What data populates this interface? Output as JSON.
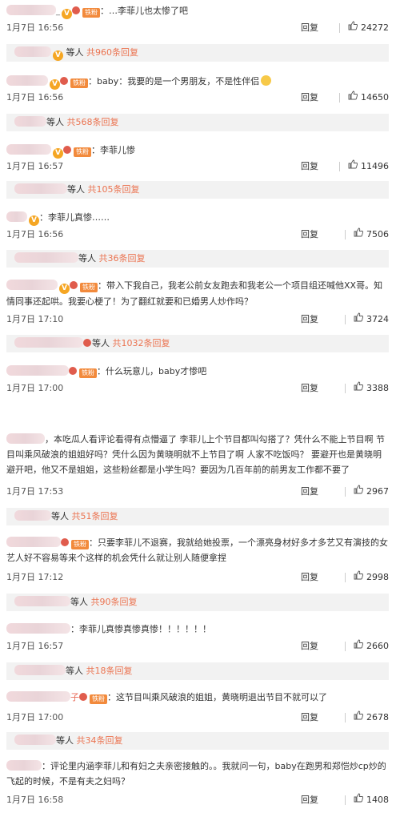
{
  "panel1": {
    "comments": [
      {
        "text": "…李菲儿也太惨了吧",
        "time": "1月7日 16:56",
        "reply": "回复",
        "likes": "24272",
        "replies": {
          "who": "等人",
          "count": "共960条回复"
        }
      },
      {
        "text": "baby：我要的是一个男朋友，不是性伴侣",
        "time": "1月7日 16:56",
        "reply": "回复",
        "likes": "14650",
        "replies": {
          "who": "等人",
          "count": "共568条回复"
        }
      },
      {
        "text": "李菲儿惨",
        "time": "1月7日 16:57",
        "reply": "回复",
        "likes": "11496",
        "replies": {
          "who": "等人",
          "count": "共105条回复"
        }
      },
      {
        "text": "李菲儿真惨……",
        "time": "1月7日 16:56",
        "reply": "回复",
        "likes": "7506",
        "replies": {
          "who": "等人",
          "count": "共36条回复"
        }
      },
      {
        "text": "带入下我自己，我老公前女友跑去和我老公一个项目组还喊他XX哥。知情同事还起哄。我要心梗了！为了翻红就要和已婚男人炒作吗？",
        "time": "1月7日 17:10",
        "reply": "回复",
        "likes": "3724",
        "replies": {
          "who": "等人",
          "count": "共1032条回复"
        }
      },
      {
        "text": "什么玩意儿，baby才惨吧",
        "time": "1月7日 17:00",
        "reply": "回复",
        "likes": "3388"
      }
    ]
  },
  "panel2": {
    "comments": [
      {
        "text": "，本吃瓜人看评论看得有点懵逼了 李菲儿上个节目都叫勾搭了？凭什么不能上节目啊 节目叫乘风破浪的姐姐好吗？凭什么因为黄晓明就不上节目了啊 人家不吃饭吗？ 要避开也是黄晓明避开吧，他又不是姐姐，这些粉丝都是小学生吗？要因为几百年前的前男友工作都不要了",
        "time": "1月7日 17:53",
        "reply": "回复",
        "likes": "2967",
        "replies": {
          "who": "等人",
          "count": "共51条回复"
        }
      },
      {
        "text": "只要李菲儿不退赛，我就给她投票，一个漂亮身材好多才多艺又有演技的女艺人好不容易等来个这样的机会凭什么就让别人随便拿捏",
        "time": "1月7日 17:12",
        "reply": "回复",
        "likes": "2998",
        "replies": {
          "who": "等人",
          "count": "共90条回复"
        }
      },
      {
        "text": "李菲儿真惨真惨真惨！！！！！！",
        "time": "1月7日 16:57",
        "reply": "回复",
        "likes": "2660",
        "replies": {
          "who": "等人",
          "count": "共18条回复"
        }
      },
      {
        "text": "这节目叫乘风破浪的姐姐，黄晓明退出节目不就可以了",
        "time": "1月7日 17:00",
        "reply": "回复",
        "likes": "2678",
        "replies": {
          "who": "等人",
          "count": "共34条回复"
        }
      },
      {
        "text": "评论里内涵李菲儿和有妇之夫亲密接触的。。我就问一句，baby在跑男和郑恺炒cp炒的飞起的时候，不是有夫之妇吗？",
        "time": "1月7日 16:58",
        "reply": "回复",
        "likes": "1408"
      }
    ]
  },
  "badges": {
    "v": "V",
    "fan": "铁粉"
  },
  "icons": {
    "thumb": "thumbs-up-icon",
    "emoji": "grin-emoji-icon"
  }
}
